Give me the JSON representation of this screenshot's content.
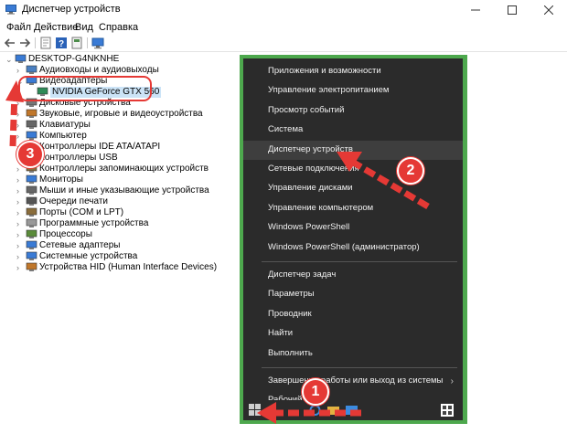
{
  "window": {
    "title": "Диспетчер устройств"
  },
  "menu": [
    "Файл",
    "Действие",
    "Вид",
    "Справка"
  ],
  "tree": {
    "root": "DESKTOP-G4NKNHE",
    "items": [
      {
        "label": "Аудиовходы и аудиовыходы",
        "icon": "audio-icon"
      },
      {
        "label": "Видеоадаптеры",
        "icon": "display-adapter-icon",
        "expanded": true
      },
      {
        "label": "NVIDIA GeForce GTX 560",
        "icon": "gpu-icon",
        "child": true
      },
      {
        "label": "Дисковые устройства",
        "icon": "disk-icon"
      },
      {
        "label": "Звуковые, игровые и видеоустройства",
        "icon": "sound-icon"
      },
      {
        "label": "Клавиатуры",
        "icon": "keyboard-icon"
      },
      {
        "label": "Компьютер",
        "icon": "computer-icon"
      },
      {
        "label": "Контроллеры IDE ATA/ATAPI",
        "icon": "ide-controller-icon"
      },
      {
        "label": "Контроллеры USB",
        "icon": "usb-icon"
      },
      {
        "label": "Контроллеры запоминающих устройств",
        "icon": "storage-controller-icon"
      },
      {
        "label": "Мониторы",
        "icon": "monitor-icon"
      },
      {
        "label": "Мыши и иные указывающие устройства",
        "icon": "mouse-icon"
      },
      {
        "label": "Очереди печати",
        "icon": "printer-icon"
      },
      {
        "label": "Порты (COM и LPT)",
        "icon": "port-icon"
      },
      {
        "label": "Программные устройства",
        "icon": "software-device-icon"
      },
      {
        "label": "Процессоры",
        "icon": "processor-icon"
      },
      {
        "label": "Сетевые адаптеры",
        "icon": "network-adapter-icon"
      },
      {
        "label": "Системные устройства",
        "icon": "system-device-icon"
      },
      {
        "label": "Устройства HID (Human Interface Devices)",
        "icon": "hid-icon"
      }
    ]
  },
  "context_menu": {
    "group1": [
      "Приложения и возможности",
      "Управление электропитанием",
      "Просмотр событий",
      "Система",
      "Диспетчер устройств",
      "Сетевые подключения",
      "Управление дисками",
      "Управление компьютером",
      "Windows PowerShell",
      "Windows PowerShell (администратор)"
    ],
    "group2": [
      "Диспетчер задач",
      "Параметры",
      "Проводник",
      "Найти",
      "Выполнить"
    ],
    "group3": [
      "Завершение работы или выход из системы",
      "Рабочий стол"
    ]
  },
  "annotations": {
    "step1": "1",
    "step2": "2",
    "step3": "3"
  },
  "colors": {
    "annotation": "#e53935",
    "menu_bg": "#2b2b2b",
    "frame": "#4da84d",
    "selection": "#cce4f7"
  }
}
